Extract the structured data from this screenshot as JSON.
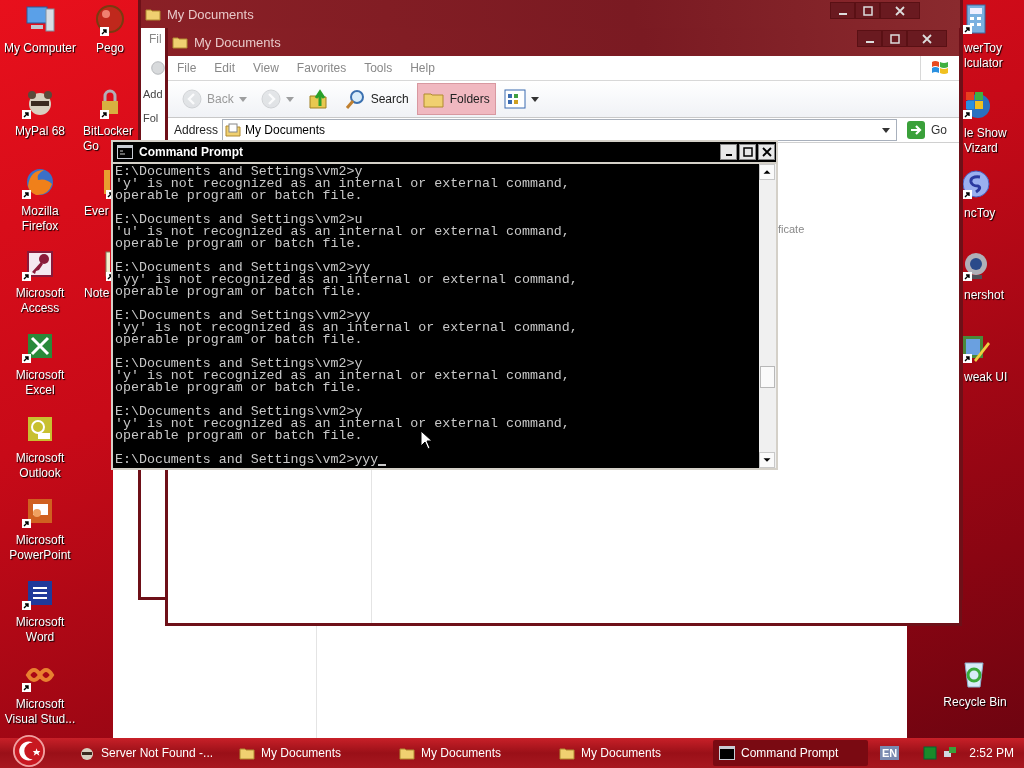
{
  "desktop_icons": {
    "left_column": [
      {
        "lines": [
          "My Computer"
        ],
        "shortcut": false
      },
      {
        "lines": [
          "MyPal 68"
        ],
        "shortcut": true
      },
      {
        "lines": [
          "Mozilla",
          "Firefox"
        ],
        "shortcut": true
      },
      {
        "lines": [
          "Microsoft",
          "Access"
        ],
        "shortcut": true
      },
      {
        "lines": [
          "Microsoft",
          "Excel"
        ],
        "shortcut": true
      },
      {
        "lines": [
          "Microsoft",
          "Outlook"
        ],
        "shortcut": false
      },
      {
        "lines": [
          "Microsoft",
          "PowerPoint"
        ],
        "shortcut": true
      },
      {
        "lines": [
          "Microsoft",
          "Word"
        ],
        "shortcut": true
      },
      {
        "lines": [
          "Microsoft",
          "Visual Stud..."
        ],
        "shortcut": true
      }
    ],
    "second_column": [
      {
        "lines": [
          "Pego"
        ],
        "shortcut": true
      },
      {
        "lines": [
          "BitLocker",
          "Go"
        ],
        "shortcut": true
      },
      {
        "lines": [
          "Ever"
        ],
        "shortcut": true
      },
      {
        "lines": [
          "Note"
        ],
        "shortcut": true
      }
    ],
    "right_column": [
      {
        "lines": [
          "werToy",
          "lculator"
        ],
        "shortcut": true
      },
      {
        "lines": [
          "le Show",
          "Vizard"
        ],
        "shortcut": true
      },
      {
        "lines": [
          "ncToy"
        ],
        "shortcut": true
      },
      {
        "lines": [
          "nershot"
        ],
        "shortcut": true
      },
      {
        "lines": [
          "weak UI"
        ],
        "shortcut": true
      },
      {
        "lines": [
          "Recycle Bin"
        ],
        "shortcut": false
      }
    ]
  },
  "back_window": {
    "title": "My Documents",
    "menu_fragment": "Fil",
    "address_fragment": "Add",
    "folders_fragment": "Fol"
  },
  "explorer_window": {
    "title": "My Documents",
    "menu": [
      "File",
      "Edit",
      "View",
      "Favorites",
      "Tools",
      "Help"
    ],
    "toolbar": [
      {
        "kind": "back",
        "label": "Back",
        "disabled": true,
        "selected": false
      },
      {
        "kind": "forward",
        "disabled": true,
        "selected": false
      },
      {
        "kind": "up",
        "disabled": false,
        "selected": false
      },
      {
        "kind": "search",
        "label": "Search",
        "disabled": false,
        "selected": false
      },
      {
        "kind": "folders",
        "label": "Folders",
        "disabled": false,
        "selected": true
      },
      {
        "kind": "views",
        "disabled": false,
        "selected": false
      }
    ],
    "address": {
      "label": "Address",
      "value": "My Documents",
      "go": "Go"
    },
    "content_fragment": "ficate"
  },
  "command_prompt": {
    "title": "Command Prompt",
    "entries": [
      {
        "prompt": "E:\\Documents and Settings\\vm2>y",
        "output": [
          "'y' is not recognized as an internal or external command,",
          "operable program or batch file."
        ]
      },
      {
        "prompt": "E:\\Documents and Settings\\vm2>u",
        "output": [
          "'u' is not recognized as an internal or external command,",
          "operable program or batch file."
        ]
      },
      {
        "prompt": "E:\\Documents and Settings\\vm2>yy",
        "output": [
          "'yy' is not recognized as an internal or external command,",
          "operable program or batch file."
        ]
      },
      {
        "prompt": "E:\\Documents and Settings\\vm2>yy",
        "output": [
          "'yy' is not recognized as an internal or external command,",
          "operable program or batch file."
        ]
      },
      {
        "prompt": "E:\\Documents and Settings\\vm2>y",
        "output": [
          "'y' is not recognized as an internal or external command,",
          "operable program or batch file."
        ]
      },
      {
        "prompt": "E:\\Documents and Settings\\vm2>y",
        "output": [
          "'y' is not recognized as an internal or external command,",
          "operable program or batch file."
        ]
      }
    ],
    "current_prompt": "E:\\Documents and Settings\\vm2>yyy"
  },
  "taskbar": {
    "items": [
      {
        "label": "Server Not Found -...",
        "kind": "browser",
        "selected": false
      },
      {
        "label": "My Documents",
        "kind": "folder",
        "selected": false
      },
      {
        "label": "My Documents",
        "kind": "folder",
        "selected": false
      },
      {
        "label": "My Documents",
        "kind": "folder",
        "selected": false
      },
      {
        "label": "Command Prompt",
        "kind": "console",
        "selected": true
      }
    ],
    "language": "EN",
    "clock": "2:52 PM"
  }
}
